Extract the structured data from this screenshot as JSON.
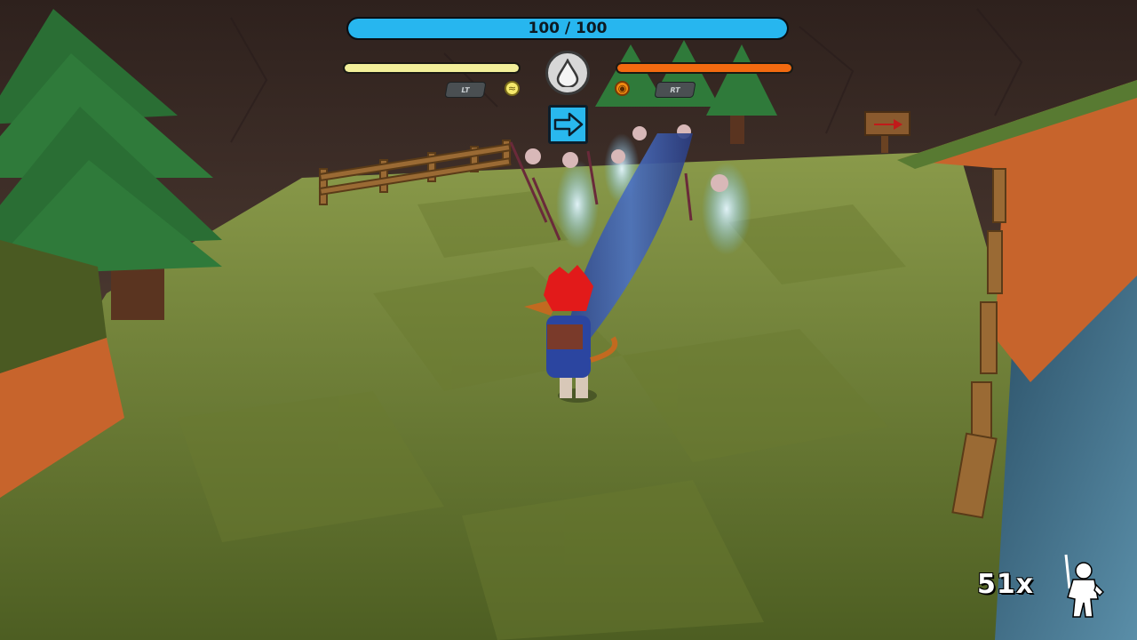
{
  "hud": {
    "health": {
      "current": 100,
      "max": 100,
      "text": "100 / 100",
      "color": "#27b6ef"
    },
    "left_gauge": {
      "fraction": 1.0,
      "color": "#f2ef9a"
    },
    "right_gauge": {
      "fraction": 1.0,
      "color": "#f26a10"
    },
    "left_trigger_label": "LT",
    "right_trigger_label": "RT",
    "center_element_icon": "water-drop-icon",
    "dash_skill_icon": "dash-arrow-icon",
    "combo": {
      "text": "51x",
      "icon": "warrior-silhouette-icon"
    }
  },
  "colors": {
    "grass_light": "#7d8a3a",
    "grass_dark": "#5c6e2a",
    "cliff": "#3d2c27",
    "tree": "#2f7a3a",
    "wood": "#a06a2c",
    "water": "#3f6f8a",
    "slash": "#3b57a8"
  }
}
